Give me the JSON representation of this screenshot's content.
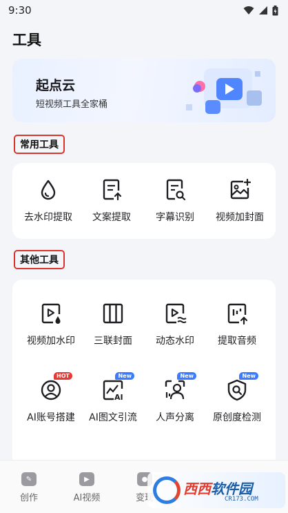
{
  "status_bar": {
    "time": "9:30"
  },
  "page": {
    "title": "工具"
  },
  "banner": {
    "title": "起点云",
    "subtitle": "短视频工具全家桶"
  },
  "common_tools": {
    "label": "常用工具",
    "items": [
      {
        "label": "去水印提取",
        "icon": "water-drop-icon"
      },
      {
        "label": "文案提取",
        "icon": "document-upload-icon"
      },
      {
        "label": "字幕识别",
        "icon": "document-search-icon"
      },
      {
        "label": "视频加封面",
        "icon": "image-add-icon"
      }
    ]
  },
  "other_tools": {
    "label": "其他工具",
    "items": [
      {
        "label": "视频加水印",
        "icon": "video-watermark-icon"
      },
      {
        "label": "三联封面",
        "icon": "triple-cover-icon"
      },
      {
        "label": "动态水印",
        "icon": "dynamic-watermark-icon"
      },
      {
        "label": "提取音频",
        "icon": "extract-audio-icon"
      },
      {
        "label": "AI账号搭建",
        "icon": "ai-account-icon",
        "badge": "HOT"
      },
      {
        "label": "AI图文引流",
        "icon": "ai-chart-icon",
        "badge": "New"
      },
      {
        "label": "人声分离",
        "icon": "voice-separation-icon",
        "badge": "New"
      },
      {
        "label": "原创度检测",
        "icon": "originality-check-icon",
        "badge": "New"
      }
    ]
  },
  "tabbar": {
    "items": [
      {
        "label": "创作",
        "icon": "create-icon"
      },
      {
        "label": "AI视频",
        "icon": "ai-video-icon"
      },
      {
        "label": "变现",
        "icon": "monetize-icon"
      }
    ]
  },
  "watermark": {
    "brand_a": "西西",
    "brand_b": "软件园",
    "url": "CR173.COM"
  },
  "colors": {
    "accent": "#d9332b",
    "badge_hot": "#e53935",
    "badge_new": "#3a7bff",
    "icon_stroke": "#1d1d22"
  }
}
